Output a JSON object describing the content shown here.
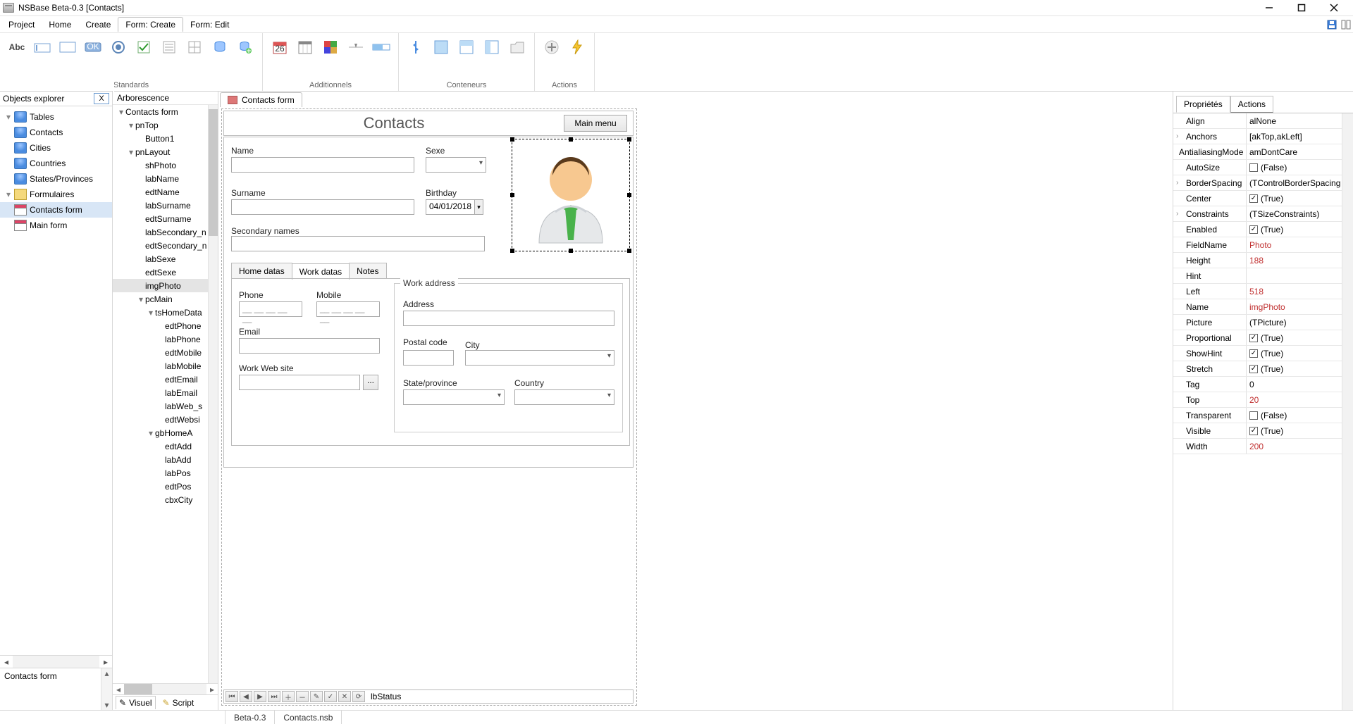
{
  "titlebar": {
    "title": "NSBase Beta-0.3 [Contacts]"
  },
  "menubar": {
    "items": [
      "Project",
      "Home",
      "Create",
      "Form: Create",
      "Form: Edit"
    ],
    "active_index": 3
  },
  "ribbon": {
    "groups": {
      "standards": "Standards",
      "additionnels": "Additionnels",
      "conteneurs": "Conteneurs",
      "actions": "Actions"
    }
  },
  "objects_explorer": {
    "title": "Objects explorer",
    "close": "X",
    "nodes": {
      "tables": "Tables",
      "contacts": "Contacts",
      "cities": "Cities",
      "countries": "Countries",
      "states": "States/Provinces",
      "formulaires": "Formulaires",
      "contacts_form": "Contacts form",
      "main_form": "Main form"
    },
    "detail": "Contacts form"
  },
  "arborescence": {
    "title": "Arborescence",
    "items": [
      "Contacts form",
      "pnTop",
      "Button1",
      "pnLayout",
      "shPhoto",
      "labName",
      "edtName",
      "labSurname",
      "edtSurname",
      "labSecondary_n",
      "edtSecondary_n",
      "labSexe",
      "edtSexe",
      "imgPhoto",
      "pcMain",
      "tsHomeData",
      "edtPhone",
      "labPhone",
      "edtMobile",
      "labMobile",
      "edtEmail",
      "labEmail",
      "labWeb_s",
      "edtWebsi",
      "gbHomeA",
      "edtAdd",
      "labAdd",
      "labPos",
      "edtPos",
      "cbxCity"
    ],
    "bottom_tabs": {
      "visuel": "Visuel",
      "script": "Script"
    }
  },
  "tabstrip": {
    "tab0": "Contacts form"
  },
  "form": {
    "title": "Contacts",
    "main_menu": "Main menu",
    "labels": {
      "name": "Name",
      "surname": "Surname",
      "secondary": "Secondary names",
      "sexe": "Sexe",
      "birthday": "Birthday",
      "birthday_val": "04/01/2018",
      "phone": "Phone",
      "mobile": "Mobile",
      "email": "Email",
      "website": "Work Web site",
      "website_btn": "...",
      "workaddr": "Work address",
      "address": "Address",
      "postal": "Postal code",
      "city": "City",
      "state": "State/province",
      "country": "Country"
    },
    "phone_mask": "__ __ __ __ __",
    "mobile_mask": "__ __ __ __ __",
    "tabs": {
      "home": "Home datas",
      "work": "Work datas",
      "notes": "Notes"
    },
    "nav_status": "lbStatus"
  },
  "properties": {
    "tabs": {
      "prop": "Propriétés",
      "act": "Actions"
    },
    "rows": [
      {
        "expand": "",
        "k": "Align",
        "v": "alNone",
        "red": false,
        "cb": null
      },
      {
        "expand": "›",
        "k": "Anchors",
        "v": "[akTop,akLeft]",
        "red": false,
        "cb": null
      },
      {
        "expand": "",
        "k": "AntialiasingMode",
        "v": "amDontCare",
        "red": false,
        "cb": null
      },
      {
        "expand": "",
        "k": "AutoSize",
        "v": "(False)",
        "red": false,
        "cb": false
      },
      {
        "expand": "›",
        "k": "BorderSpacing",
        "v": "(TControlBorderSpacing",
        "red": false,
        "cb": null
      },
      {
        "expand": "",
        "k": "Center",
        "v": "(True)",
        "red": false,
        "cb": true
      },
      {
        "expand": "›",
        "k": "Constraints",
        "v": "(TSizeConstraints)",
        "red": false,
        "cb": null
      },
      {
        "expand": "",
        "k": "Enabled",
        "v": "(True)",
        "red": false,
        "cb": true
      },
      {
        "expand": "",
        "k": "FieldName",
        "v": "Photo",
        "red": true,
        "cb": null
      },
      {
        "expand": "",
        "k": "Height",
        "v": "188",
        "red": true,
        "cb": null
      },
      {
        "expand": "",
        "k": "Hint",
        "v": "",
        "red": false,
        "cb": null
      },
      {
        "expand": "",
        "k": "Left",
        "v": "518",
        "red": true,
        "cb": null
      },
      {
        "expand": "",
        "k": "Name",
        "v": "imgPhoto",
        "red": true,
        "cb": null
      },
      {
        "expand": "",
        "k": "Picture",
        "v": "(TPicture)",
        "red": false,
        "cb": null
      },
      {
        "expand": "",
        "k": "Proportional",
        "v": "(True)",
        "red": false,
        "cb": true
      },
      {
        "expand": "",
        "k": "ShowHint",
        "v": "(True)",
        "red": false,
        "cb": true
      },
      {
        "expand": "",
        "k": "Stretch",
        "v": "(True)",
        "red": false,
        "cb": true
      },
      {
        "expand": "",
        "k": "Tag",
        "v": "0",
        "red": false,
        "cb": null
      },
      {
        "expand": "",
        "k": "Top",
        "v": "20",
        "red": true,
        "cb": null
      },
      {
        "expand": "",
        "k": "Transparent",
        "v": "(False)",
        "red": false,
        "cb": false
      },
      {
        "expand": "",
        "k": "Visible",
        "v": "(True)",
        "red": false,
        "cb": true
      },
      {
        "expand": "",
        "k": "Width",
        "v": "200",
        "red": true,
        "cb": null
      }
    ]
  },
  "statusbar": {
    "version": "Beta-0.3",
    "file": "Contacts.nsb"
  }
}
